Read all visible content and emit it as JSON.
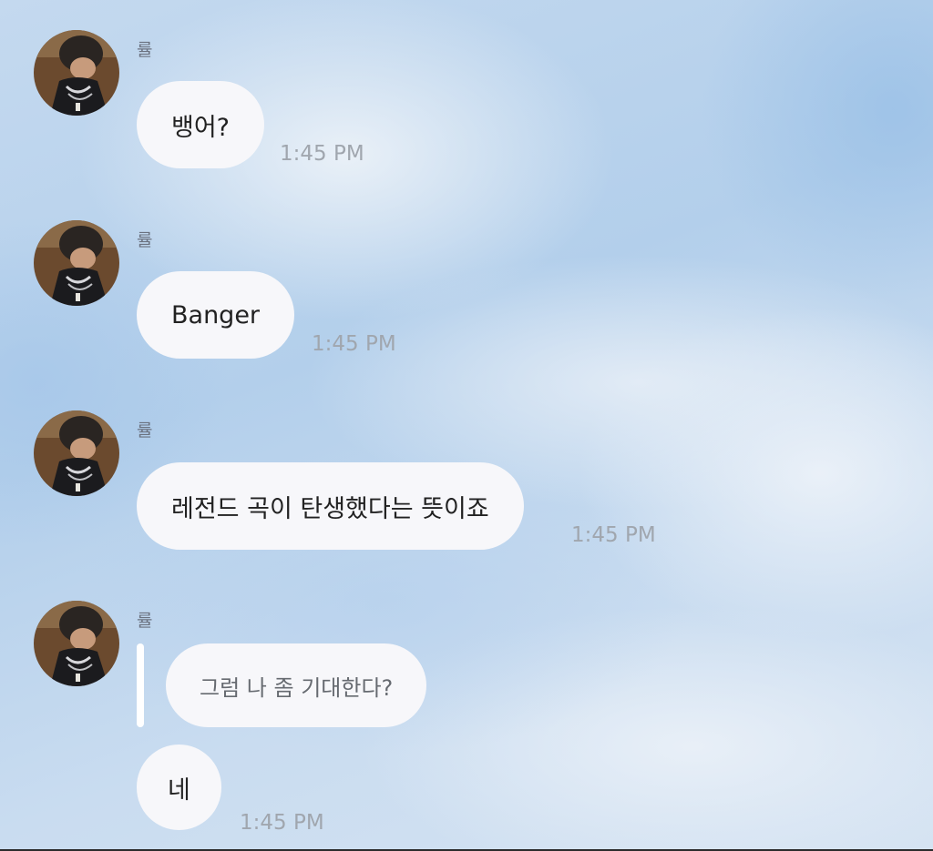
{
  "messages": [
    {
      "sender": "률",
      "text": "뱅어?",
      "time": "1:45 PM"
    },
    {
      "sender": "률",
      "text": "Banger",
      "time": "1:45 PM"
    },
    {
      "sender": "률",
      "text": "레전드 곡이 탄생했다는 뜻이죠",
      "time": "1:45 PM"
    },
    {
      "sender": "률",
      "quoted_text": "그럼 나 좀 기대한다?",
      "text": "네",
      "time": "1:45 PM"
    }
  ],
  "colors": {
    "bubble": "#f7f7fa",
    "timestamp": "#a0a6ae",
    "sender_name": "#6b7280",
    "reply_bar": "#ffffff"
  },
  "icons": {
    "avatar": "profile-photo"
  }
}
